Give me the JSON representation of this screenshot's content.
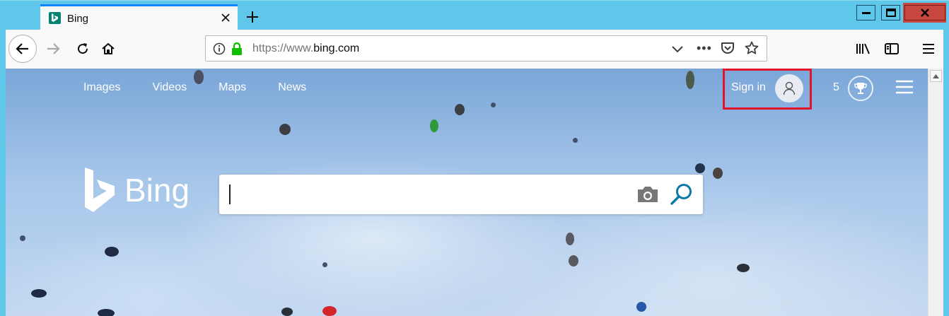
{
  "browser": {
    "tab_title": "Bing",
    "url_scheme": "https://www.",
    "url_domain": "bing.com",
    "url_more": "•••"
  },
  "page": {
    "nav_links": [
      "Images",
      "Videos",
      "Maps",
      "News"
    ],
    "sign_in_label": "Sign in",
    "rewards_count": "5",
    "logo_text": "Bing"
  },
  "colors": {
    "tab_accent": "#0a84ff",
    "window_frame": "#5fc8ea",
    "highlight_box": "#e3142a",
    "bing_teal": "#008373"
  }
}
